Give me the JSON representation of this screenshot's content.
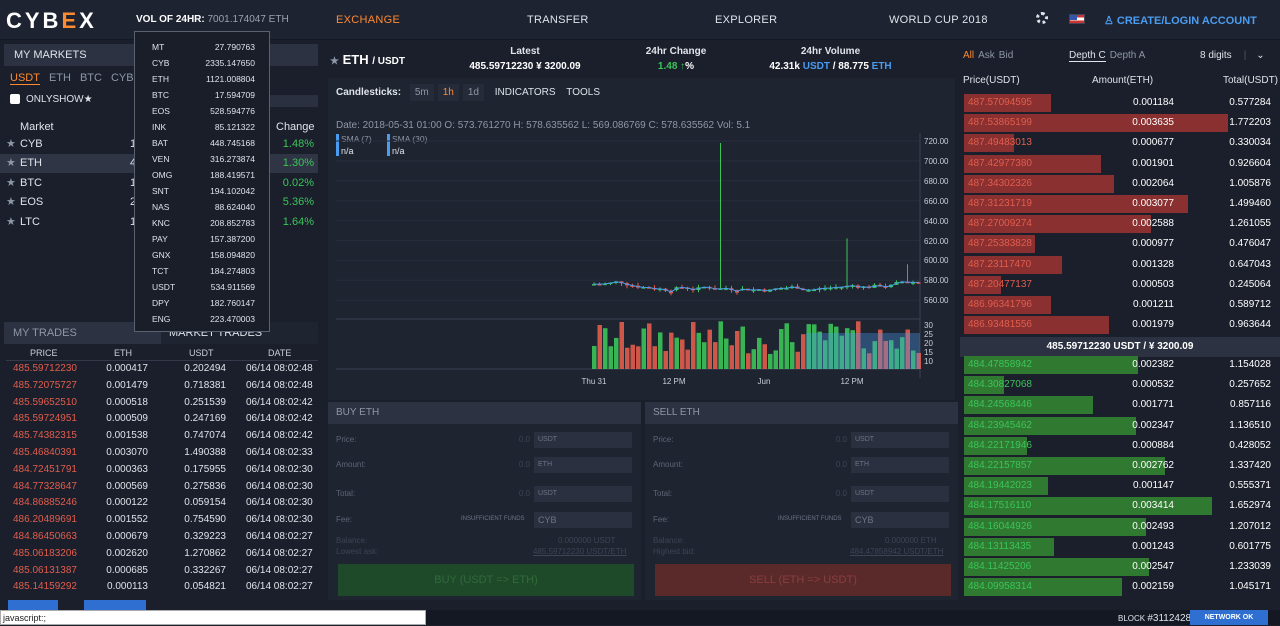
{
  "logo": {
    "pre": "CYB",
    "x": "E",
    "post": "X"
  },
  "volume": {
    "label": "VOL OF 24HR:",
    "value": "7001.174047 ETH"
  },
  "nav": {
    "exchange": "EXCHANGE",
    "transfer": "TRANSFER",
    "explorer": "EXPLORER",
    "worldcup": "WORLD CUP 2018",
    "login": "CREATE/LOGIN ACCOUNT"
  },
  "volume_popup": [
    [
      "MT",
      "27.790763"
    ],
    [
      "CYB",
      "2335.147650"
    ],
    [
      "ETH",
      "1121.008804"
    ],
    [
      "BTC",
      "17.594709"
    ],
    [
      "EOS",
      "528.594776"
    ],
    [
      "INK",
      "85.121322"
    ],
    [
      "BAT",
      "448.745168"
    ],
    [
      "VEN",
      "316.273874"
    ],
    [
      "OMG",
      "188.419571"
    ],
    [
      "SNT",
      "194.102042"
    ],
    [
      "NAS",
      "88.624040"
    ],
    [
      "KNC",
      "208.852783"
    ],
    [
      "PAY",
      "157.387200"
    ],
    [
      "GNX",
      "158.094820"
    ],
    [
      "TCT",
      "184.274803"
    ],
    [
      "USDT",
      "534.911569"
    ],
    [
      "DPY",
      "182.760147"
    ],
    [
      "ENG",
      "223.470003"
    ]
  ],
  "markets": {
    "title": "MY MARKETS",
    "tabs": [
      "USDT",
      "ETH",
      "BTC",
      "CYB"
    ],
    "onlyshow": "ONLYSHOW★",
    "col_market": "Market",
    "col_change": "Change",
    "rows": [
      {
        "name": "CYB",
        "price": "15",
        "change": "1.48%"
      },
      {
        "name": "ETH",
        "price": "4",
        "change": "1.30%"
      },
      {
        "name": "BTC",
        "price": "1",
        "change": "0.02%"
      },
      {
        "name": "EOS",
        "price": "2",
        "change": "5.36%"
      },
      {
        "name": "LTC",
        "price": "1",
        "change": "1.64%"
      }
    ]
  },
  "trades": {
    "tab_my": "MY TRADES",
    "tab_market": "MARKET TRADES",
    "cols": [
      "PRICE",
      "ETH",
      "USDT",
      "DATE"
    ],
    "rows": [
      [
        "485.59712230",
        "0.000417",
        "0.202494",
        "06/14 08:02:48"
      ],
      [
        "485.72075727",
        "0.001479",
        "0.718381",
        "06/14 08:02:48"
      ],
      [
        "485.59652510",
        "0.000518",
        "0.251539",
        "06/14 08:02:42"
      ],
      [
        "485.59724951",
        "0.000509",
        "0.247169",
        "06/14 08:02:42"
      ],
      [
        "485.74382315",
        "0.001538",
        "0.747074",
        "06/14 08:02:42"
      ],
      [
        "485.46840391",
        "0.003070",
        "1.490388",
        "06/14 08:02:33"
      ],
      [
        "484.72451791",
        "0.000363",
        "0.175955",
        "06/14 08:02:30"
      ],
      [
        "484.77328647",
        "0.000569",
        "0.275836",
        "06/14 08:02:30"
      ],
      [
        "484.86885246",
        "0.000122",
        "0.059154",
        "06/14 08:02:30"
      ],
      [
        "486.20489691",
        "0.001552",
        "0.754590",
        "06/14 08:02:30"
      ],
      [
        "484.86450663",
        "0.000679",
        "0.329223",
        "06/14 08:02:27"
      ],
      [
        "485.06183206",
        "0.002620",
        "1.270862",
        "06/14 08:02:27"
      ],
      [
        "485.06131387",
        "0.000685",
        "0.332267",
        "06/14 08:02:27"
      ],
      [
        "485.14159292",
        "0.000113",
        "0.054821",
        "06/14 08:02:27"
      ]
    ]
  },
  "pair": {
    "base": "ETH",
    "quote": "/ USDT"
  },
  "ticker": {
    "latest_label": "Latest",
    "latest": "485.59712230  ¥ 3200.09",
    "change_label": "24hr Change",
    "change": "1.48",
    "change_arrow": "↑",
    "change_unit": "%",
    "volume_label": "24hr Volume",
    "vol_usdt": "42.31k",
    "usdt": "USDT",
    "vol_eth": " / 88.775",
    "eth": "ETH"
  },
  "chart_toolbar": {
    "label": "Candlesticks:",
    "tf": [
      "5m",
      "1h",
      "1d"
    ],
    "indicators": "INDICATORS",
    "tools": "TOOLS"
  },
  "chart_info": "Date: 2018-05-31 01:00  O: 573.761270  H: 578.635562  L: 569.086769  C: 578.635562  Vol: 5.1",
  "sma": [
    {
      "label": "SMA (7)",
      "value": "n/a"
    },
    {
      "label": "SMA (30)",
      "value": "n/a"
    }
  ],
  "chart_data": {
    "type": "candlestick",
    "y_ticks": [
      "720.00",
      "700.00",
      "680.00",
      "660.00",
      "640.00",
      "620.00",
      "600.00",
      "580.00",
      "560.00"
    ],
    "vol_ticks": [
      "30",
      "25",
      "20",
      "15",
      "10"
    ],
    "x_ticks": [
      "Thu 31",
      "12 PM",
      "Jun",
      "12 PM"
    ],
    "colors": {
      "up": "#3cc45a",
      "down": "#e25d4d",
      "sma": "#4a9cf0"
    }
  },
  "buy": {
    "title": "BUY ETH",
    "price": "Price:",
    "amount": "Amount:",
    "total": "Total:",
    "fee": "Fee:",
    "cur": "USDT",
    "cur_eth": "ETH",
    "zero": "0.0",
    "insufficient": "INSUFFICIENT FUNDS",
    "fee_cur": "CYB",
    "balance": "Balance:",
    "balance_val": "0.000000 USDT",
    "lowest": "Lowest ask:",
    "lowest_val": "485.59712230 USDT/ETH",
    "button": "BUY (USDT => ETH)"
  },
  "sell": {
    "title": "SELL ETH",
    "price": "Price:",
    "amount": "Amount:",
    "total": "Total:",
    "fee": "Fee:",
    "cur": "USDT",
    "cur_eth": "ETH",
    "zero": "0.0",
    "insufficient": "INSUFFICIENT FUNDS",
    "fee_cur": "CYB",
    "balance": "Balance:",
    "balance_val": "0.000000 ETH",
    "highest": "Highest bid:",
    "highest_val": "484.47858942 USDT/ETH",
    "button": "SELL (ETH => USDT)"
  },
  "orderbook": {
    "tabs": [
      "All",
      "Ask",
      "Bid"
    ],
    "depth": [
      "Depth C",
      "Depth A"
    ],
    "digits": "8 digits",
    "cols": [
      "Price(USDT)",
      "Amount(ETH)",
      "Total(USDT)"
    ],
    "asks": [
      [
        "487.57094595",
        "0.001184",
        "0.577284",
        0.33
      ],
      [
        "487.53865199",
        "0.003635",
        "1.772203",
        1.0
      ],
      [
        "487.49483013",
        "0.000677",
        "0.330034",
        0.19
      ],
      [
        "487.42977380",
        "0.001901",
        "0.926604",
        0.52
      ],
      [
        "487.34302326",
        "0.002064",
        "1.005876",
        0.57
      ],
      [
        "487.31231719",
        "0.003077",
        "1.499460",
        0.85
      ],
      [
        "487.27009274",
        "0.002588",
        "1.261055",
        0.71
      ],
      [
        "487.25383828",
        "0.000977",
        "0.476047",
        0.27
      ],
      [
        "487.23117470",
        "0.001328",
        "0.647043",
        0.37
      ],
      [
        "487.20477137",
        "0.000503",
        "0.245064",
        0.14
      ],
      [
        "486.96341796",
        "0.001211",
        "0.589712",
        0.33
      ],
      [
        "486.93481556",
        "0.001979",
        "0.963644",
        0.55
      ]
    ],
    "mid": "485.59712230 USDT / ¥ 3200.09",
    "bids": [
      [
        "484.47858942",
        "0.002382",
        "1.154028",
        0.66
      ],
      [
        "484.30827068",
        "0.000532",
        "0.257652",
        0.15
      ],
      [
        "484.24568446",
        "0.001771",
        "0.857116",
        0.49
      ],
      [
        "484.23945462",
        "0.002347",
        "1.136510",
        0.65
      ],
      [
        "484.22171946",
        "0.000884",
        "0.428052",
        0.24
      ],
      [
        "484.22157857",
        "0.002762",
        "1.337420",
        0.76
      ],
      [
        "484.19442023",
        "0.001147",
        "0.555371",
        0.32
      ],
      [
        "484.17516110",
        "0.003414",
        "1.652974",
        0.94
      ],
      [
        "484.16044926",
        "0.002493",
        "1.207012",
        0.69
      ],
      [
        "484.13113435",
        "0.001243",
        "0.601775",
        0.34
      ],
      [
        "484.11425206",
        "0.002547",
        "1.233039",
        0.7
      ],
      [
        "484.09958314",
        "0.002159",
        "1.045171",
        0.6
      ]
    ]
  },
  "status": {
    "url": "javascript:;",
    "block_label": "BLOCK",
    "block": "#3112428",
    "network": "NETWORK OK"
  }
}
